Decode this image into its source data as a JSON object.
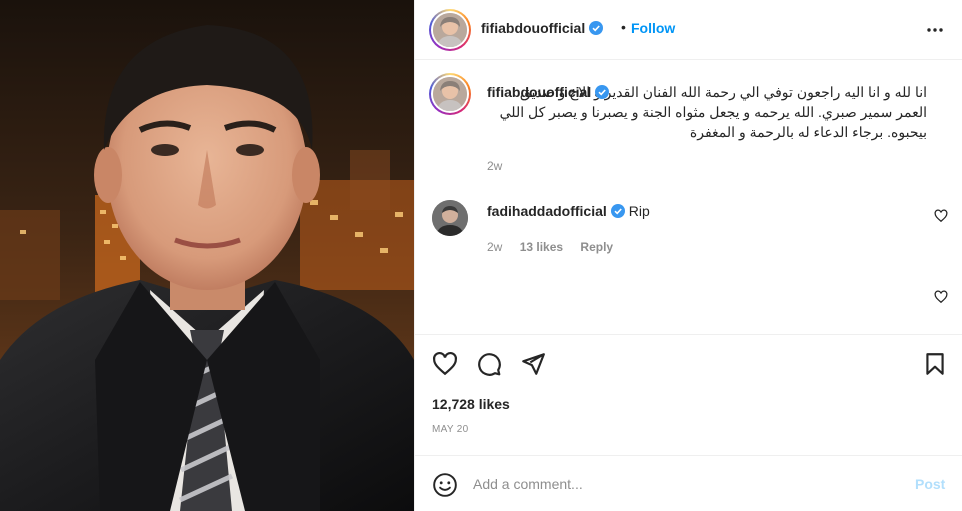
{
  "post": {
    "username": "fifiabdouofficial",
    "verified": true,
    "follow_label": "Follow",
    "separator": "•",
    "caption": "انا لله و انا اليه راجعون توفي الي رحمة الله الفنان القدير و الاخ و صديق العمر سمير صبري. الله يرحمه و يجعل مثواه الجنة و يصبرنا و يصبر كل اللي بيحبوه. برجاء الدعاء له بالرحمة و المغفرة",
    "caption_time": "2w",
    "comments": [
      {
        "username": "fadihaddadofficial",
        "verified": true,
        "text": "Rip",
        "time": "2w",
        "likes": "13 likes",
        "reply_label": "Reply"
      }
    ],
    "likes": "12,728 likes",
    "date": "MAY 20"
  },
  "comment_bar": {
    "placeholder": "Add a comment...",
    "post_label": "Post"
  },
  "icons": {
    "more": "more-options-icon",
    "verified": "verified-badge-icon",
    "like": "heart-icon",
    "comment": "comment-icon",
    "share": "paper-plane-icon",
    "save": "bookmark-icon",
    "emoji": "emoji-icon"
  },
  "colors": {
    "accent": "#0095f6",
    "verified": "#3897f0",
    "muted": "#8e8e8e",
    "post_disabled": "#b2dffc"
  }
}
